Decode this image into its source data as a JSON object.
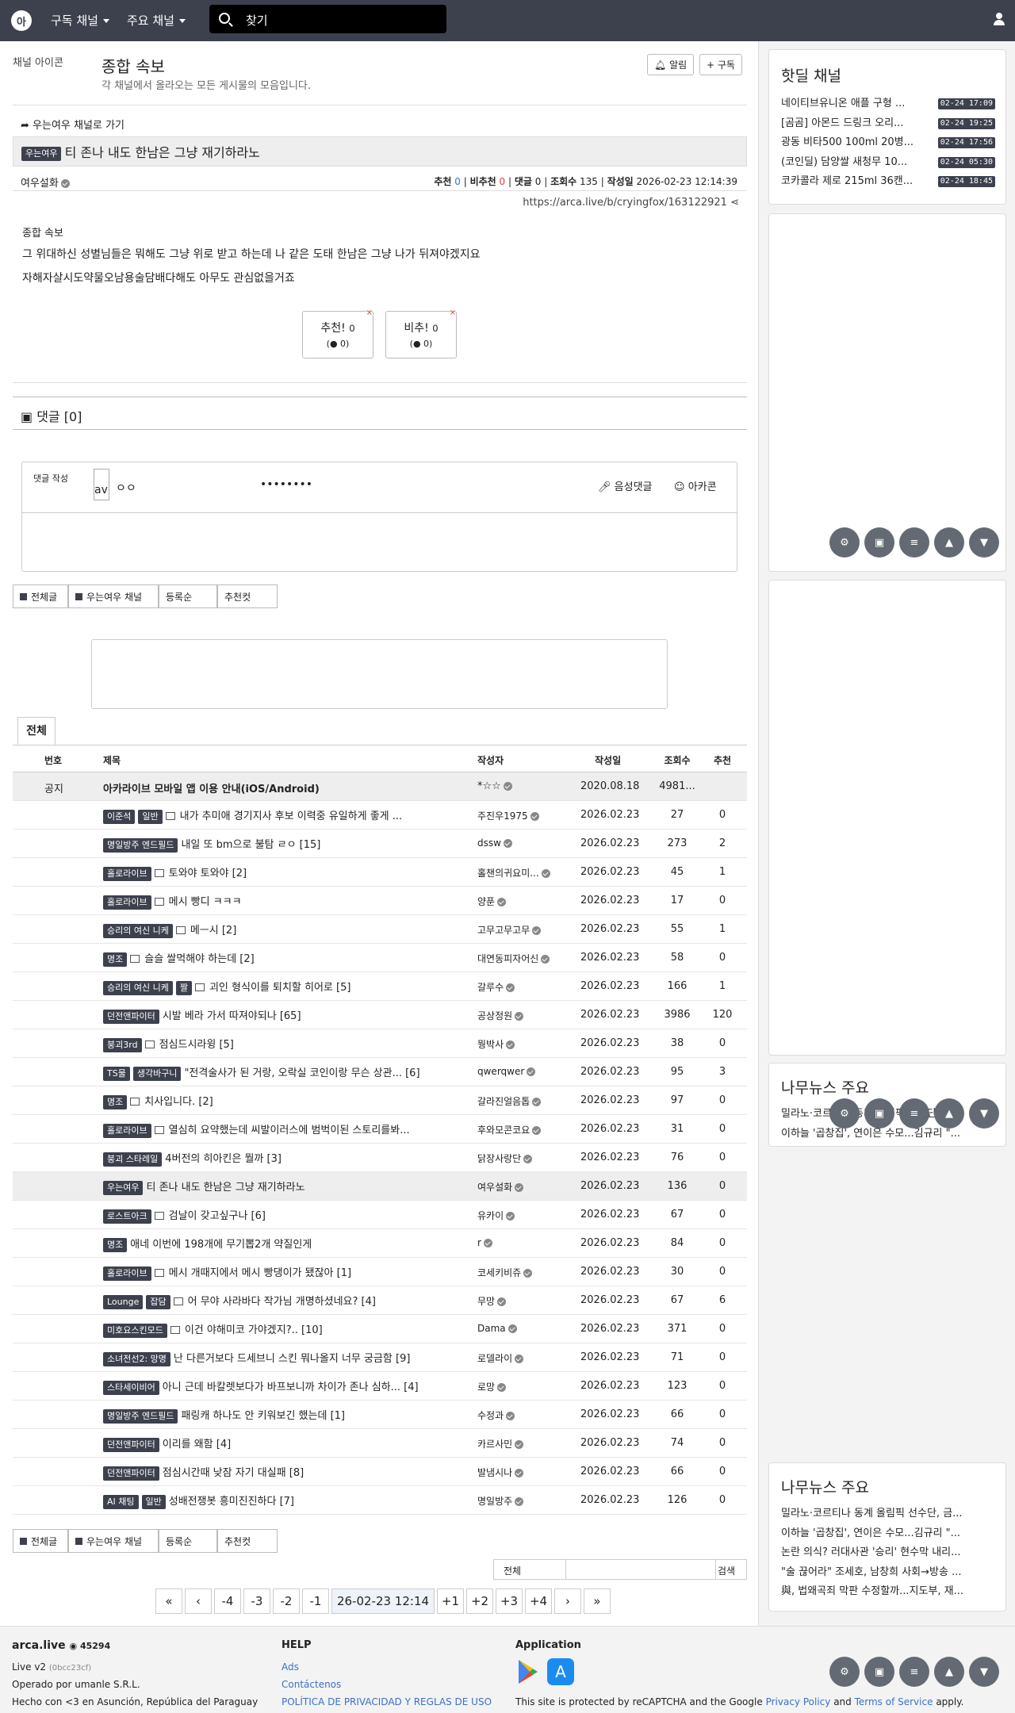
{
  "nav": {
    "menu1": "구독 채널",
    "menu2": "주요 채널",
    "search_placeholder": "찾기"
  },
  "channel": {
    "icon_alt": "채널 아이콘",
    "title": "종합 속보",
    "desc": "각 채널에서 올라오는 모든 게시물의 모음입니다.",
    "alarm": "알림",
    "subscribe": "구독"
  },
  "article": {
    "goto": "우는여우 채널로 가기",
    "tag": "우는여우",
    "title": "티 존나 내도 한남은 그냥 재기하라노",
    "author": "여우설화",
    "rec_label": "추천",
    "rec": "0",
    "unrec_label": "비추천",
    "unrec": "0",
    "cmt_label": "댓글",
    "cmt": "0",
    "view_label": "조회수",
    "view": "135",
    "date_label": "작성일",
    "date": "2026-02-23 12:14:39",
    "url": "https://arca.live/b/cryingfox/163122921",
    "img_alt": "종합 속보",
    "body1": "그 위대하신 성별님들은 뭐해도 그냥 위로 받고 하는데 나 같은 도태 한남은 그냥 나가 뒤져야겠지요",
    "body2": "자해자살시도약물오남용술담배다해도 아무도 관심없을거죠",
    "up_label": "추천!",
    "up_count": "0",
    "up_sub": "0",
    "down_label": "비추!",
    "down_count": "0",
    "down_sub": "0"
  },
  "comments": {
    "header": "댓글 [0]",
    "write_label": "댓글 작성",
    "avatar_alt": "av",
    "nick": "ㅇㅇ",
    "password": "••••••••",
    "voice": "음성댓글",
    "emoticon": "아카콘"
  },
  "tabs": {
    "all": "전체글",
    "channel": "우는여우 채널",
    "sort": "등록순",
    "best": "추천컷"
  },
  "list": {
    "tab": "전체",
    "headers": {
      "no": "번호",
      "title": "제목",
      "author": "작성자",
      "date": "작성일",
      "views": "조회수",
      "rec": "추천"
    },
    "notice": {
      "no": "공지",
      "title": "아카라이브 모바일 앱 이용 안내(iOS/Android)",
      "author": "*☆☆",
      "date": "2020.08.18",
      "views": "4981...",
      "rec": ""
    },
    "rows": [
      {
        "tags": [
          "이준석",
          "일반"
        ],
        "doc": true,
        "title": "내가 추미애 경기지사 후보 이력중 유일하게 좋게 ...",
        "author": "주진우1975",
        "date": "2026.02.23",
        "views": "27",
        "rec": "0"
      },
      {
        "tags": [
          "명일방주 엔드필드"
        ],
        "doc": false,
        "title": "내일 또 bm으로 불탐 ㄹㅇ [15]",
        "author": "dssw",
        "date": "2026.02.23",
        "views": "273",
        "rec": "2"
      },
      {
        "tags": [
          "홀로라이브"
        ],
        "doc": true,
        "title": "토와야 토와야 [2]",
        "author": "홀챈의귀요미...",
        "date": "2026.02.23",
        "views": "45",
        "rec": "1"
      },
      {
        "tags": [
          "홀로라이브"
        ],
        "doc": true,
        "title": "메시 빵디 ㅋㅋㅋ",
        "author": "양푼",
        "date": "2026.02.23",
        "views": "17",
        "rec": "0"
      },
      {
        "tags": [
          "승리의 여신 니케"
        ],
        "doc": true,
        "title": "메ㅡ시 [2]",
        "author": "고무고무고무",
        "date": "2026.02.23",
        "views": "55",
        "rec": "1"
      },
      {
        "tags": [
          "명조"
        ],
        "doc": true,
        "title": "슬슬 쌀먹해야 하는데 [2]",
        "author": "대연동피자어신",
        "date": "2026.02.23",
        "views": "58",
        "rec": "0"
      },
      {
        "tags": [
          "승리의 여신 니케",
          "짤"
        ],
        "doc": true,
        "title": "괴인 형식이를 퇴치할 히어로 [5]",
        "author": "갈루수",
        "date": "2026.02.23",
        "views": "166",
        "rec": "1"
      },
      {
        "tags": [
          "던전앤파이터"
        ],
        "doc": false,
        "title": "시발 베라 가서 따져야되나 [65]",
        "author": "공상정원",
        "date": "2026.02.23",
        "views": "3986",
        "rec": "120"
      },
      {
        "tags": [
          "붕괴3rd"
        ],
        "doc": true,
        "title": "점심드시라윙 [5]",
        "author": "뭥박사",
        "date": "2026.02.23",
        "views": "38",
        "rec": "0"
      },
      {
        "tags": [
          "TS물",
          "생각바구니"
        ],
        "doc": false,
        "title": "\"전격술사가 된 거랑, 오락실 코인이랑 무슨 상관... [6]",
        "author": "qwerqwer",
        "date": "2026.02.23",
        "views": "95",
        "rec": "3"
      },
      {
        "tags": [
          "명조"
        ],
        "doc": true,
        "title": "치사입니다. [2]",
        "author": "갈라진얼음톱",
        "date": "2026.02.23",
        "views": "97",
        "rec": "0"
      },
      {
        "tags": [
          "홀로라이브"
        ],
        "doc": true,
        "title": "열심히 요약했는데 씨발이러스에 범벅이된 스토리를봐...",
        "author": "후와모콘코요",
        "date": "2026.02.23",
        "views": "31",
        "rec": "0"
      },
      {
        "tags": [
          "붕괴 스타레일"
        ],
        "doc": false,
        "title": "4버전의 히아킨은 뭘까 [3]",
        "author": "닭장사랑단",
        "date": "2026.02.23",
        "views": "76",
        "rec": "0"
      },
      {
        "tags": [
          "우는여우"
        ],
        "doc": false,
        "title": "티 존나 내도 한남은 그냥 재기하라노",
        "author": "여우설화",
        "date": "2026.02.23",
        "views": "136",
        "rec": "0",
        "highlight": true
      },
      {
        "tags": [
          "로스트아크"
        ],
        "doc": true,
        "title": "검날이 갖고싶구나 [6]",
        "author": "유카이",
        "date": "2026.02.23",
        "views": "67",
        "rec": "0"
      },
      {
        "tags": [
          "명조"
        ],
        "doc": false,
        "title": "애네 이번에 198개에 무기뽑2개 약질인게",
        "author": "r",
        "date": "2026.02.23",
        "views": "84",
        "rec": "0"
      },
      {
        "tags": [
          "홀로라이브"
        ],
        "doc": true,
        "title": "메시 개때지에서 메시 빵댕이가 됐잖아 [1]",
        "author": "코세키비쥬",
        "date": "2026.02.23",
        "views": "30",
        "rec": "0"
      },
      {
        "tags": [
          "Lounge",
          "잡담"
        ],
        "doc": true,
        "title": "어 무야 사라바다 작가님 개명하셨네요? [4]",
        "author": "무망",
        "date": "2026.02.23",
        "views": "67",
        "rec": "6"
      },
      {
        "tags": [
          "미호요스킨모드"
        ],
        "doc": true,
        "title": "이건 야해미코 가야겠지?.. [10]",
        "author": "Dama",
        "date": "2026.02.23",
        "views": "371",
        "rec": "0"
      },
      {
        "tags": [
          "소녀전선2: 망명"
        ],
        "doc": false,
        "title": "난 다른거보다 드세브니 스킨 뭐나올지 너무 궁금함 [9]",
        "author": "로델라이",
        "date": "2026.02.23",
        "views": "71",
        "rec": "0"
      },
      {
        "tags": [
          "스타세이비어"
        ],
        "doc": false,
        "title": "아니 근데 바칼렛보다가 바프보니까 차이가 존나 심하... [4]",
        "author": "로망",
        "date": "2026.02.23",
        "views": "123",
        "rec": "0"
      },
      {
        "tags": [
          "명일방주 엔드필드"
        ],
        "doc": false,
        "title": "패링캐 하나도 안 키워보긴 했는데 [1]",
        "author": "수정과",
        "date": "2026.02.23",
        "views": "66",
        "rec": "0"
      },
      {
        "tags": [
          "던전앤파이터"
        ],
        "doc": false,
        "title": "이리를 왜함 [4]",
        "author": "카르사민",
        "date": "2026.02.23",
        "views": "74",
        "rec": "0"
      },
      {
        "tags": [
          "던전앤파이터"
        ],
        "doc": false,
        "title": "점심시간때 낮잠 자기 대실패 [8]",
        "author": "발냄시나",
        "date": "2026.02.23",
        "views": "66",
        "rec": "0"
      },
      {
        "tags": [
          "AI 채팅",
          "일반"
        ],
        "doc": false,
        "title": "성배전쟁봇 흥미진진하다 [7]",
        "author": "명일방주",
        "date": "2026.02.23",
        "views": "126",
        "rec": "0"
      }
    ]
  },
  "bottom_search": {
    "scope": "전체",
    "button": "검색"
  },
  "pagination": [
    "«",
    "‹",
    "-4",
    "-3",
    "-2",
    "-1",
    "26-02-23 12:14",
    "+1",
    "+2",
    "+3",
    "+4",
    "›",
    "»"
  ],
  "sidebar": {
    "hot_title": "핫딜 채널",
    "hot": [
      {
        "text": "네이티브유니온 애플 구형 ...",
        "time": "02-24 17:09"
      },
      {
        "text": "[곰곰] 아몬드 드링크 오리...",
        "time": "02-24 19:25"
      },
      {
        "text": "광동 비타500 100ml 20병...",
        "time": "02-24 17:56"
      },
      {
        "text": "(코인딜) 담양쌀 새청무 10...",
        "time": "02-24 05:30"
      },
      {
        "text": "코카콜라 제로 215ml 36캔...",
        "time": "02-24 18:45"
      }
    ],
    "news1_title": "나무뉴스 주요",
    "news1": [
      "밀라노·코르티나 동계 올림픽 선수단, 금...",
      "이하늘 '곱창집', 연이은 수모...김규리 \"..."
    ],
    "news2_title": "나무뉴스 주요",
    "news2": [
      "밀라노·코르티나 동계 올림픽 선수단, 금...",
      "이하늘 '곱창집', 연이은 수모...김규리 \"...",
      "논란 의식? 러대사관 '승리' 현수막 내리...",
      "\"술 끊어라\" 조세호, 남창희 사회→방송 ...",
      "與, 법왜곡죄 막판 수정할까...지도부, 재..."
    ]
  },
  "footer": {
    "site": "arca.live",
    "online": "45294",
    "version": "Live v2",
    "build": "(0bcc23cf)",
    "operator": "Operado por umanle S.R.L.",
    "made": "Hecho con <3 en Asunción, República del Paraguay",
    "help_title": "HELP",
    "help_links": [
      "Ads",
      "Contáctenos",
      "POLÍTICA DE PRIVACIDAD Y REGLAS DE USO"
    ],
    "app_title": "Application",
    "recaptcha": "This site is protected by reCAPTCHA and the Google",
    "privacy": "Privacy Policy",
    "and": "and",
    "terms": "Terms of Service",
    "apply": "apply."
  },
  "colors": {
    "topbar": "#3d414d",
    "accent_blue": "#3b71c6",
    "red": "#e04040"
  }
}
